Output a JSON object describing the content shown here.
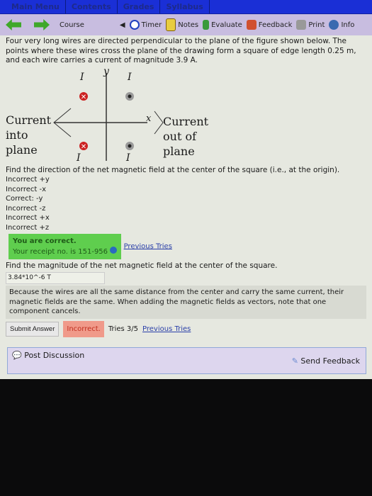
{
  "topnav": [
    "Main Menu",
    "Contents",
    "Grades",
    "Syllabus"
  ],
  "toolbar": {
    "course": "Course",
    "timer": "Timer",
    "notes": "Notes",
    "evaluate": "Evaluate",
    "feedback": "Feedback",
    "print": "Print",
    "info": "Info"
  },
  "problem": "Four very long wires are directed perpendicular to the plane of the figure shown below. The points where these wires cross the plane of the drawing form a square of edge length 0.25 m, and each wire carries a current of magnitude 3.9 A.",
  "figure": {
    "current_label": "I",
    "y_axis": "y",
    "x_axis": "x",
    "left_label": [
      "Current",
      "into",
      "plane"
    ],
    "right_label": [
      "Current",
      "out of",
      "plane"
    ]
  },
  "q1": {
    "prompt": "Find the direction of the net magnetic field at the center of the square (i.e., at the origin).",
    "options": [
      "Incorrect +y",
      "Incorrect -x",
      "Correct: -y",
      "Incorrect -z",
      "Incorrect +x",
      "Incorrect +z"
    ],
    "correct_title": "You are correct.",
    "receipt": "Your receipt no. is 151-956",
    "previous": "Previous Tries"
  },
  "q2": {
    "prompt": "Find the magnitude of the net magnetic field at the center of the square.",
    "answer": "3.84*10^-6 T",
    "hint": "Because the wires are all the same distance from the center and carry the same current, their magnetic fields are the same. When adding the magnetic fields as vectors, note that one component cancels.",
    "submit": "Submit Answer",
    "status": "Incorrect.",
    "tries": "Tries 3/5",
    "previous": "Previous Tries"
  },
  "footer": {
    "post": "Post Discussion",
    "send": "Send Feedback"
  }
}
